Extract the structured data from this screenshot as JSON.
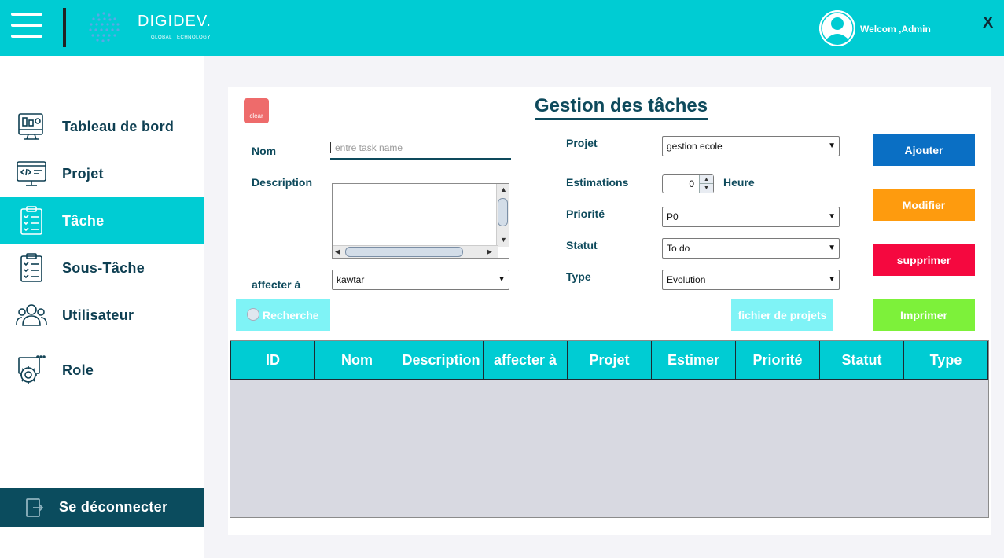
{
  "header": {
    "brand": "DIGIDEV.",
    "brand_sub": "GLOBAL TECHNOLOGY",
    "welcome": "Welcom ,Admin",
    "close": "X"
  },
  "sidebar": {
    "items": [
      {
        "label": "Tableau de bord",
        "icon": "dashboard-icon"
      },
      {
        "label": "Projet",
        "icon": "code-monitor-icon"
      },
      {
        "label": "Tâche",
        "icon": "clipboard-checklist-icon",
        "active": true
      },
      {
        "label": "Sous-Tâche",
        "icon": "clipboard-list-icon"
      },
      {
        "label": "Utilisateur",
        "icon": "users-icon"
      },
      {
        "label": "Role",
        "icon": "gear-icon"
      }
    ],
    "logout": "Se déconnecter"
  },
  "form": {
    "clear": "clear",
    "title": "Gestion des tâches",
    "nom_label": "Nom",
    "nom_placeholder": "entre task name",
    "description_label": "Description",
    "affecter_label": "affecter à",
    "affecter_value": "kawtar",
    "projet_label": "Projet",
    "projet_value": "gestion ecole",
    "estimations_label": "Estimations",
    "estimations_value": "0",
    "heure_label": "Heure",
    "priorite_label": "Priorité",
    "priorite_value": "P0",
    "statut_label": "Statut",
    "statut_value": "To do",
    "type_label": "Type",
    "type_value": "Evolution"
  },
  "buttons": {
    "ajouter": "Ajouter",
    "modifier": "Modifier",
    "supprimer": "supprimer",
    "imprimer": "Imprimer",
    "recherche": "Recherche",
    "fichier": "fichier de projets"
  },
  "table": {
    "columns": [
      "ID",
      "Nom",
      "Description",
      "affecter à",
      "Projet",
      "Estimer",
      "Priorité",
      "Statut",
      "Type"
    ],
    "rows": []
  },
  "colors": {
    "accent": "#00ccd3",
    "dark": "#0e4a5c",
    "ajouter": "#0a6fc4",
    "modifier": "#fe9b0e",
    "supprimer": "#f5083f",
    "imprimer": "#7df13a"
  }
}
